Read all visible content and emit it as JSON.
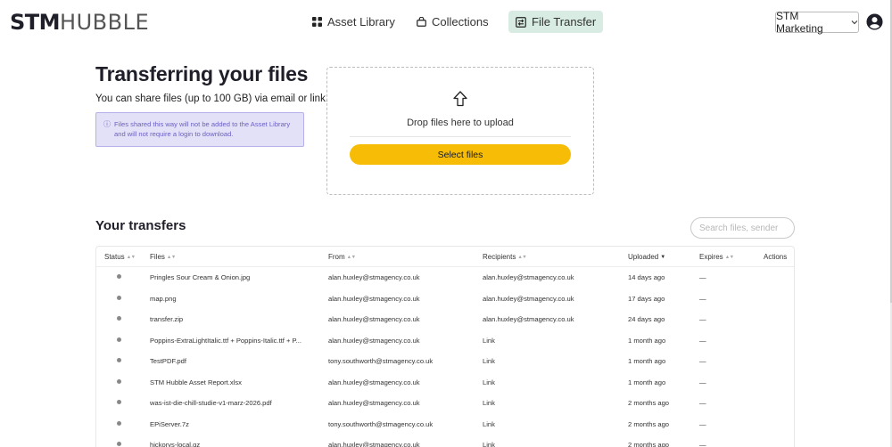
{
  "brand": {
    "logo_bold": "STM",
    "logo_light": "HUBBLE"
  },
  "nav": {
    "asset_library": "Asset Library",
    "collections": "Collections",
    "file_transfer": "File Transfer"
  },
  "account": {
    "org": "STM Marketing"
  },
  "intro": {
    "title": "Transferring your files",
    "description": "You can share files (up to 100 GB) via email or link.",
    "info": "Files shared this way will not be added to the Asset Library and will not require a login to download."
  },
  "dropzone": {
    "text": "Drop files here to upload",
    "button": "Select files"
  },
  "transfers": {
    "title": "Your transfers",
    "search_placeholder": "Search files, sender",
    "columns": {
      "status": "Status",
      "files": "Files",
      "from": "From",
      "recipients": "Recipients",
      "uploaded": "Uploaded",
      "expires": "Expires",
      "actions": "Actions"
    },
    "rows": [
      {
        "files": "Pringles Sour Cream & Onion.jpg",
        "from": "alan.huxley@stmagency.co.uk",
        "recipients": "alan.huxley@stmagency.co.uk",
        "uploaded": "14 days ago",
        "expires": "—"
      },
      {
        "files": "map.png",
        "from": "alan.huxley@stmagency.co.uk",
        "recipients": "alan.huxley@stmagency.co.uk",
        "uploaded": "17 days ago",
        "expires": "—"
      },
      {
        "files": "transfer.zip",
        "from": "alan.huxley@stmagency.co.uk",
        "recipients": "alan.huxley@stmagency.co.uk",
        "uploaded": "24 days ago",
        "expires": "—"
      },
      {
        "files": "Poppins-ExtraLightItalic.ttf + Poppins-Italic.ttf + P...",
        "from": "alan.huxley@stmagency.co.uk",
        "recipients": "Link",
        "uploaded": "1 month ago",
        "expires": "—"
      },
      {
        "files": "TestPDF.pdf",
        "from": "tony.southworth@stmagency.co.uk",
        "recipients": "Link",
        "uploaded": "1 month ago",
        "expires": "—"
      },
      {
        "files": "STM Hubble Asset Report.xlsx",
        "from": "alan.huxley@stmagency.co.uk",
        "recipients": "Link",
        "uploaded": "1 month ago",
        "expires": "—"
      },
      {
        "files": "was-ist-die-chill-studie-v1-marz-2026.pdf",
        "from": "alan.huxley@stmagency.co.uk",
        "recipients": "Link",
        "uploaded": "2 months ago",
        "expires": "—"
      },
      {
        "files": "EPiServer.7z",
        "from": "tony.southworth@stmagency.co.uk",
        "recipients": "Link",
        "uploaded": "2 months ago",
        "expires": "—"
      },
      {
        "files": "hickorys-local.gz",
        "from": "alan.huxley@stmagency.co.uk",
        "recipients": "Link",
        "uploaded": "2 months ago",
        "expires": "—"
      }
    ]
  },
  "icons": {
    "asset_library": "grid-icon",
    "collections": "bag-icon",
    "file_transfer": "transfer-icon",
    "upload": "upload-arrow-icon",
    "account": "user-circle-icon",
    "info": "info-icon"
  },
  "colors": {
    "active_nav": "#d8ece3",
    "primary_button": "#f7bd06",
    "info_bg": "#e3e1f7",
    "info_text": "#6b60c4",
    "status_dot": "#888888"
  }
}
